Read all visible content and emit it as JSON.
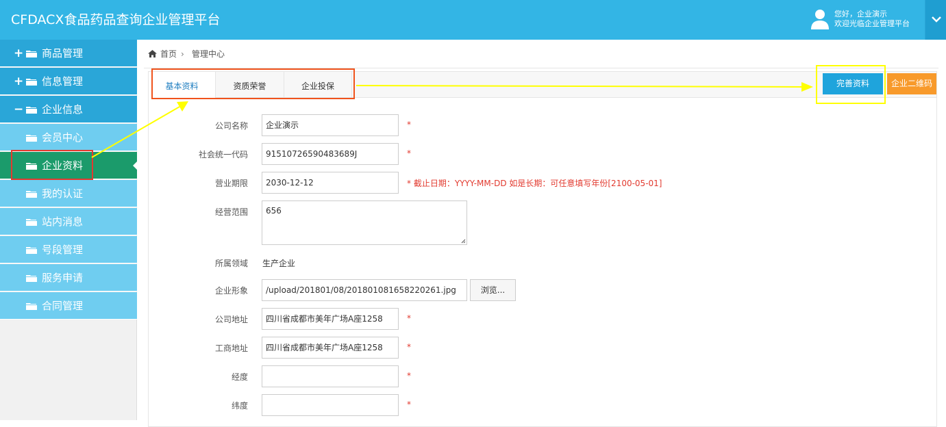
{
  "header": {
    "app_title": "CFDACX食品药品查询企业管理平台",
    "greeting": "您好，企业演示",
    "welcome": "欢迎光临企业管理平台"
  },
  "sidebar": {
    "items": [
      {
        "sign": "+",
        "label": "商品管理"
      },
      {
        "sign": "+",
        "label": "信息管理"
      },
      {
        "sign": "−",
        "label": "企业信息"
      },
      {
        "label": "会员中心"
      },
      {
        "label": "企业资料"
      },
      {
        "label": "我的认证"
      },
      {
        "label": "站内消息"
      },
      {
        "label": "号段管理"
      },
      {
        "label": "服务申请"
      },
      {
        "label": "合同管理"
      }
    ]
  },
  "breadcrumb": {
    "home": "首页",
    "separator": "›",
    "current": "管理中心"
  },
  "tabs": [
    "基本资料",
    "资质荣誉",
    "企业投保"
  ],
  "buttons": {
    "complete": "完善资料",
    "qrcode": "企业二维码",
    "browse": "浏览..."
  },
  "form": {
    "company_name": {
      "label": "公司名称",
      "value": "企业演示"
    },
    "credit_code": {
      "label": "社会统一代码",
      "value": "91510726590483689J"
    },
    "business_term": {
      "label": "营业期限",
      "value": "2030-12-12",
      "hint": "* 截止日期：YYYY-MM-DD 如是长期：可任意填写年份[2100-05-01]"
    },
    "business_scope": {
      "label": "经营范围",
      "value": "656"
    },
    "domain": {
      "label": "所属领域",
      "value": "生产企业"
    },
    "image": {
      "label": "企业形象",
      "value": "/upload/201801/08/201801081658220261.jpg"
    },
    "address": {
      "label": "公司地址",
      "value": "四川省成都市美年广场A座1258"
    },
    "reg_address": {
      "label": "工商地址",
      "value": "四川省成都市美年广场A座1258"
    },
    "longitude": {
      "label": "经度",
      "value": ""
    },
    "latitude": {
      "label": "纬度",
      "value": ""
    },
    "required_mark": "*"
  },
  "colors": {
    "header": "#33b5e5",
    "menu_top": "#2aa6d8",
    "menu_sub": "#6fcdf0",
    "menu_active": "#1b9b6b",
    "highlight_red": "#e23a2f",
    "highlight_yellow": "#ffff00",
    "btn_blue": "#1fa4dc",
    "btn_orange": "#f89a2b"
  },
  "icons": [
    "user-avatar-icon",
    "chevron-down-icon",
    "folder-icon",
    "home-icon"
  ]
}
